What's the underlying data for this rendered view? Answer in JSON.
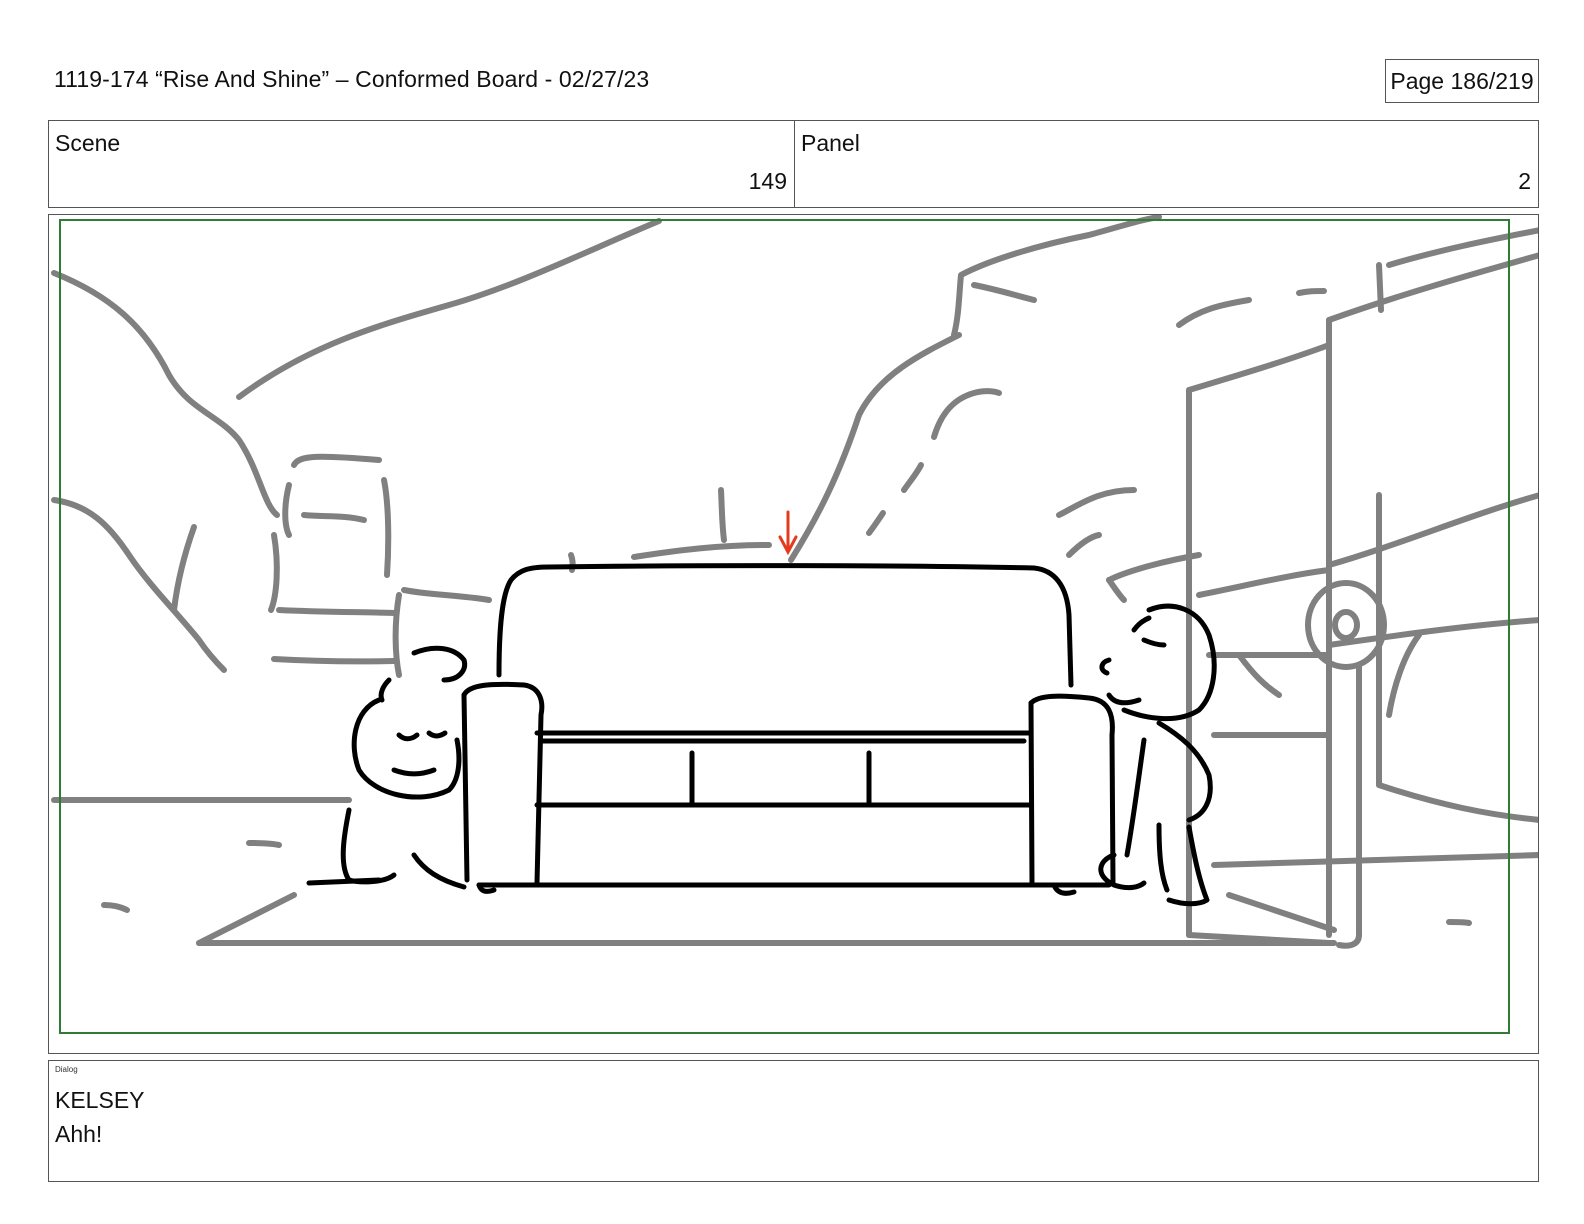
{
  "header": {
    "title": "1119-174 “Rise And Shine” – Conformed Board - 02/27/23",
    "page": "Page 186/219"
  },
  "info": {
    "scene_label": "Scene",
    "scene_value": "149",
    "panel_label": "Panel",
    "panel_value": "2"
  },
  "dialog": {
    "label": "Dialog",
    "character": "KELSEY",
    "line": "Ahh!"
  },
  "colors": {
    "safe_frame": "#2e7d32",
    "background_lines": "#808080",
    "foreground_lines": "#000000",
    "direction_arrow": "#e53a1e"
  }
}
